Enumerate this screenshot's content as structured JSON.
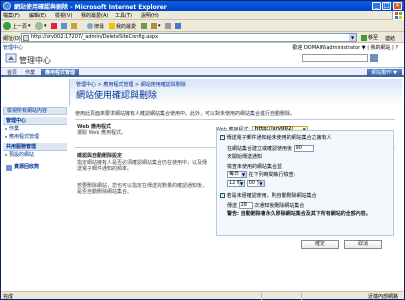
{
  "window": {
    "title": "網站使用確認與刪除 - Microsoft Internet Explorer"
  },
  "menu": [
    "檔案(F)",
    "編輯(E)",
    "檢視(V)",
    "我的最愛(A)",
    "工具(T)",
    "說明(H)"
  ],
  "toolbar": {
    "back": "上一頁",
    "search": "搜尋",
    "favorites": "我的最愛"
  },
  "address": {
    "label": "網址(D)",
    "url": "http://srv002:17207/_admin/DeleteSiteConfig.aspx",
    "go": "移至",
    "links": "連結"
  },
  "page": {
    "breadcrumb_top": "管理中心",
    "user": "歡迎 DOMAIN\\administrator ▼ | 我的網站 | ?",
    "site_title": "管理中心",
    "tabs": [
      "首頁",
      "作業",
      "應用程式管理"
    ],
    "site_actions": "網站動作 ▼",
    "left_nav": {
      "top": "檢視所有網站內容",
      "sections": [
        {
          "title": "管理中心",
          "items": [
            "作業",
            "應用程式管理"
          ]
        },
        {
          "title": "共用服務管理",
          "items": [
            "預設的網站"
          ]
        }
      ],
      "recycle": "資源回收筒"
    },
    "breadcrumb": "管理中心 > 應用程式管理 > 網站使用確認與刪除",
    "title": "網站使用確認與刪除",
    "description": "使用此頁面來要求網站擁有人確認網站集合使用中。此外，可以對未使用的網站集合進行自動刪除。",
    "web_app": {
      "section_title": "Web 應用程式",
      "section_desc": "選取 Web 應用程式。",
      "label": "Web 應用程式:",
      "value": "http://srv002/"
    },
    "confirm": {
      "section_title": "確認與自動刪除設定",
      "section_desc_1": "指定網站擁有人是否必須確認網站集合仍在使用中，以及傳送電子郵件通知的頻率。",
      "section_desc_2": "若要刪除網站，您也可以指定在傳送完數量的確認通知後，是否自動刪除網站集合。",
      "opt_notify": "傳送電子郵件通知給未使用的網站集合之擁有人",
      "opt_notify_days_label_1": "在網站集合建立或確認使用後",
      "days_value": "90",
      "opt_notify_days_label_2": "天開始傳送通知",
      "check_label": "檢查未使用的網站集合並",
      "frequency": "每日",
      "time_label": "在下列時間執行檢查:",
      "hour": "12 時",
      "minute": "00 分",
      "opt_delete": "若是未經確認使用，則自動刪除網站集合",
      "delete_label_1": "傳送",
      "notices_value": "28",
      "delete_label_2": "次通知後刪除網站集合",
      "warning": "警告: 自動刪除會永久移除網站集合及其下所有網站的全部內容。"
    },
    "ok": "確定",
    "cancel": "取消"
  },
  "status": {
    "done": "完成",
    "zone": "近端內部網路"
  }
}
